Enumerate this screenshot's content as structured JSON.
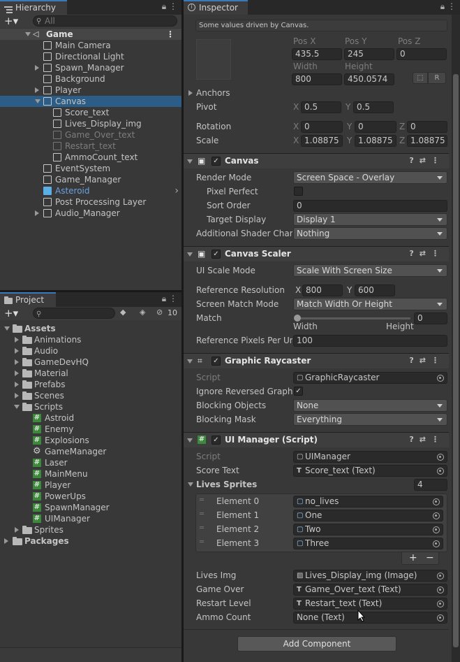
{
  "hierarchy": {
    "tab": "Hierarchy",
    "search_placeholder": "All",
    "scene": "Game",
    "items": [
      {
        "label": "Main Camera",
        "depth": 1,
        "arrow": "",
        "style": ""
      },
      {
        "label": "Directional Light",
        "depth": 1,
        "arrow": "",
        "style": ""
      },
      {
        "label": "Spawn_Manager",
        "depth": 1,
        "arrow": "r",
        "style": ""
      },
      {
        "label": "Background",
        "depth": 1,
        "arrow": "",
        "style": ""
      },
      {
        "label": "Player",
        "depth": 1,
        "arrow": "r",
        "style": ""
      },
      {
        "label": "Canvas",
        "depth": 1,
        "arrow": "d",
        "style": "sel"
      },
      {
        "label": "Score_text",
        "depth": 2,
        "arrow": "",
        "style": ""
      },
      {
        "label": "Lives_Display_img",
        "depth": 2,
        "arrow": "",
        "style": ""
      },
      {
        "label": "Game_Over_text",
        "depth": 2,
        "arrow": "",
        "style": "dim"
      },
      {
        "label": "Restart_text",
        "depth": 2,
        "arrow": "",
        "style": "dim"
      },
      {
        "label": "AmmoCount_text",
        "depth": 2,
        "arrow": "",
        "style": ""
      },
      {
        "label": "EventSystem",
        "depth": 1,
        "arrow": "",
        "style": ""
      },
      {
        "label": "Game_Manager",
        "depth": 1,
        "arrow": "",
        "style": ""
      },
      {
        "label": "Asteroid",
        "depth": 1,
        "arrow": "",
        "style": "blue"
      },
      {
        "label": "Post Processing Layer",
        "depth": 1,
        "arrow": "",
        "style": ""
      },
      {
        "label": "Audio_Manager",
        "depth": 1,
        "arrow": "r",
        "style": ""
      }
    ]
  },
  "project": {
    "tab": "Project",
    "hidden_count": "10",
    "root": "Assets",
    "folders": [
      "Animations",
      "Audio",
      "GameDevHQ",
      "Material",
      "Prefabs",
      "Scenes"
    ],
    "scripts_folder": "Scripts",
    "scripts": [
      {
        "label": "Astroid",
        "icon": "hash"
      },
      {
        "label": "Enemy",
        "icon": "hash"
      },
      {
        "label": "Explosions",
        "icon": "hash"
      },
      {
        "label": "GameManager",
        "icon": "gear"
      },
      {
        "label": "Laser",
        "icon": "hash"
      },
      {
        "label": "MainMenu",
        "icon": "hash"
      },
      {
        "label": "Player",
        "icon": "hash"
      },
      {
        "label": "PowerUps",
        "icon": "hash"
      },
      {
        "label": "SpawnManager",
        "icon": "hash"
      },
      {
        "label": "UIManager",
        "icon": "hash"
      }
    ],
    "sprites_folder": "Sprites",
    "packages": "Packages"
  },
  "inspector": {
    "tab": "Inspector",
    "driven_note": "Some values driven by Canvas.",
    "rect": {
      "posx_label": "Pos X",
      "posy_label": "Pos Y",
      "posz_label": "Pos Z",
      "posx": "435.5",
      "posy": "245",
      "posz": "0",
      "width_label": "Width",
      "height_label": "Height",
      "width": "800",
      "height": "450.0574",
      "r_btn": "R",
      "anchors": "Anchors",
      "pivot": "Pivot",
      "pivot_x": "0.5",
      "pivot_y": "0.5",
      "rotation": "Rotation",
      "rot_x": "0",
      "rot_y": "0",
      "rot_z": "0",
      "scale": "Scale",
      "scale_x": "1.08875",
      "scale_y": "1.08875",
      "scale_z": "1.08875",
      "x": "X",
      "y": "Y",
      "z": "Z"
    },
    "canvas": {
      "title": "Canvas",
      "render_mode_label": "Render Mode",
      "render_mode": "Screen Space - Overlay",
      "pixel_perfect": "Pixel Perfect",
      "sort_order_label": "Sort Order",
      "sort_order": "0",
      "target_display_label": "Target Display",
      "target_display": "Display 1",
      "shader_label": "Additional Shader Chann",
      "shader": "Nothing"
    },
    "scaler": {
      "title": "Canvas Scaler",
      "mode_label": "UI Scale Mode",
      "mode": "Scale With Screen Size",
      "ref_res_label": "Reference Resolution",
      "ref_x": "800",
      "ref_y": "600",
      "match_mode_label": "Screen Match Mode",
      "match_mode": "Match Width Or Height",
      "match_label": "Match",
      "match": "0",
      "width": "Width",
      "height": "Height",
      "ppu_label": "Reference Pixels Per Uni",
      "ppu": "100"
    },
    "raycaster": {
      "title": "Graphic Raycaster",
      "script_label": "Script",
      "script": "GraphicRaycaster",
      "ignore_label": "Ignore Reversed Graphic",
      "blocking_label": "Blocking Objects",
      "blocking": "None",
      "mask_label": "Blocking Mask",
      "mask": "Everything"
    },
    "uimanager": {
      "title": "UI Manager (Script)",
      "script_label": "Script",
      "script": "UIManager",
      "score_label": "Score Text",
      "score": "Score_text (Text)",
      "lives_sprites_label": "Lives Sprites",
      "lives_count": "4",
      "elements": [
        {
          "label": "Element 0",
          "value": "no_lives"
        },
        {
          "label": "Element 1",
          "value": "One"
        },
        {
          "label": "Element 2",
          "value": "Two"
        },
        {
          "label": "Element 3",
          "value": "Three"
        }
      ],
      "lives_img_label": "Lives Img",
      "lives_img": "Lives_Display_img (Image)",
      "game_over_label": "Game Over",
      "game_over": "Game_Over_text (Text)",
      "restart_label": "Restart Level",
      "restart": "Restart_text (Text)",
      "ammo_label": "Ammo Count",
      "ammo": "None (Text)"
    },
    "add_component": "Add Component"
  }
}
